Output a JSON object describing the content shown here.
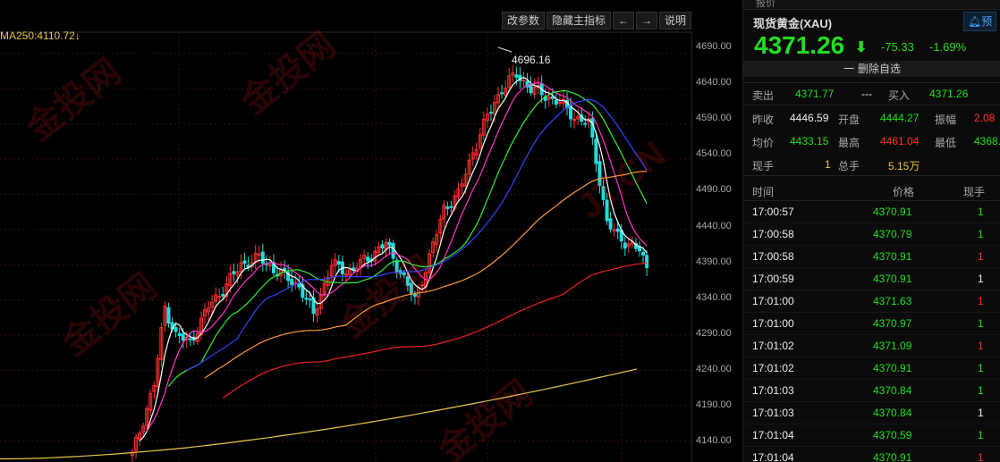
{
  "toolbar": {
    "params_label": "改参数",
    "hide_indicator_label": "隐藏主指标",
    "prev_icon": "←",
    "next_icon": "→",
    "help_label": "说明"
  },
  "ma250_label": "MA250:4110.72↓",
  "peak_label": "4696.16",
  "price_axis": [
    "4690.00",
    "4640.00",
    "4590.00",
    "4540.00",
    "4490.00",
    "4440.00",
    "4390.00",
    "4340.00",
    "4290.00",
    "4240.00",
    "4190.00",
    "4140.00"
  ],
  "watermark": [
    "金投网",
    "JT.CN"
  ],
  "colors": {
    "up": "#ff3030",
    "down": "#22dddd",
    "ma5": "#ffffff",
    "ma10": "#ff33cc",
    "ma20": "#33ee33",
    "ma30": "#3344ff",
    "ma60": "#ff9933",
    "ma120": "#ee2222",
    "ma250": "#e6c84a"
  },
  "chart_data": {
    "type": "line",
    "title": "",
    "xlabel": "",
    "ylabel": "",
    "ylim": [
      4110,
      4720
    ],
    "peak": 4696.16,
    "series": [
      {
        "name": "MA250",
        "values": [
          4110.72
        ]
      }
    ]
  },
  "panel": {
    "top_tab": "报价",
    "symbol": "现货黄金(XAU)",
    "predict_label": "预",
    "price": "4371.26",
    "arrow": "⬇",
    "change": "-75.33",
    "change_pct": "-1.69%",
    "remove_label": "删除自选",
    "remove_icon": "一",
    "sell_label": "卖出",
    "sell_price": "4371.77",
    "sell_vol": "---",
    "buy_label": "买入",
    "buy_price": "4371.26",
    "stats": [
      {
        "l1": "昨收",
        "v1": "4446.59",
        "l2": "开盘",
        "v2": "4444.27",
        "l3": "振幅",
        "v3": "2.08"
      },
      {
        "l1": "均价",
        "v1": "4433.15",
        "l2": "最高",
        "v2": "4461.04",
        "l3": "最低",
        "v3": "4368."
      }
    ],
    "vol_label1": "现手",
    "vol_val1": "1",
    "vol_label2": "总手",
    "vol_val2": "5.15万",
    "hdr_time": "时间",
    "hdr_price": "价格",
    "hdr_vol": "现手",
    "trades": [
      {
        "time": "17:00:57",
        "price": "4370.91",
        "vol": "1",
        "c": "green"
      },
      {
        "time": "17:00:58",
        "price": "4370.79",
        "vol": "1",
        "c": "green"
      },
      {
        "time": "17:00:58",
        "price": "4370.91",
        "vol": "1",
        "c": "red"
      },
      {
        "time": "17:00:59",
        "price": "4370.91",
        "vol": "1",
        "c": "white"
      },
      {
        "time": "17:01:00",
        "price": "4371.63",
        "vol": "1",
        "c": "red"
      },
      {
        "time": "17:01:00",
        "price": "4370.97",
        "vol": "1",
        "c": "green"
      },
      {
        "time": "17:01:02",
        "price": "4371.09",
        "vol": "1",
        "c": "red"
      },
      {
        "time": "17:01:02",
        "price": "4370.91",
        "vol": "1",
        "c": "green"
      },
      {
        "time": "17:01:03",
        "price": "4370.84",
        "vol": "1",
        "c": "green"
      },
      {
        "time": "17:01:03",
        "price": "4370.84",
        "vol": "1",
        "c": "white"
      },
      {
        "time": "17:01:04",
        "price": "4370.59",
        "vol": "1",
        "c": "green"
      },
      {
        "time": "17:01:04",
        "price": "4370.91",
        "vol": "1",
        "c": "red"
      }
    ]
  }
}
